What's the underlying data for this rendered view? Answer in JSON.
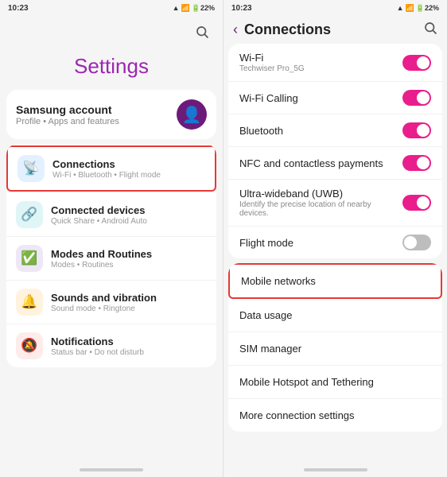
{
  "left": {
    "status": {
      "time": "10:23",
      "icons": "📶🔋22%"
    },
    "title": "Settings",
    "account": {
      "name": "Samsung account",
      "sub": "Profile • Apps and features"
    },
    "items": [
      {
        "id": "connections",
        "icon": "📡",
        "iconClass": "icon-blue",
        "title": "Connections",
        "sub": "Wi-Fi • Bluetooth • Flight mode",
        "highlighted": true
      },
      {
        "id": "connected-devices",
        "icon": "🔗",
        "iconClass": "icon-teal",
        "title": "Connected devices",
        "sub": "Quick Share • Android Auto",
        "highlighted": false
      },
      {
        "id": "modes-routines",
        "icon": "✅",
        "iconClass": "icon-purple",
        "title": "Modes and Routines",
        "sub": "Modes • Routines",
        "highlighted": false
      },
      {
        "id": "sounds-vibration",
        "icon": "🔔",
        "iconClass": "icon-orange",
        "title": "Sounds and vibration",
        "sub": "Sound mode • Ringtone",
        "highlighted": false
      },
      {
        "id": "notifications",
        "icon": "🔕",
        "iconClass": "icon-red",
        "title": "Notifications",
        "sub": "Status bar • Do not disturb",
        "highlighted": false
      }
    ]
  },
  "right": {
    "status": {
      "time": "10:23",
      "icons": "📶🔋22%"
    },
    "header": {
      "back_label": "‹",
      "title": "Connections",
      "search_label": "🔍"
    },
    "toggle_items": [
      {
        "id": "wifi",
        "title": "Wi-Fi",
        "sub": "Techwiser Pro_5G",
        "on": true
      },
      {
        "id": "wifi-calling",
        "title": "Wi-Fi Calling",
        "sub": "",
        "on": true
      },
      {
        "id": "bluetooth",
        "title": "Bluetooth",
        "sub": "",
        "on": true
      },
      {
        "id": "nfc",
        "title": "NFC and contactless payments",
        "sub": "",
        "on": true
      },
      {
        "id": "uwb",
        "title": "Ultra-wideband (UWB)",
        "sub": "Identify the precise location of nearby devices.",
        "on": true
      },
      {
        "id": "flight-mode",
        "title": "Flight mode",
        "sub": "",
        "on": false
      }
    ],
    "plain_items": [
      {
        "id": "mobile-networks",
        "title": "Mobile networks",
        "highlighted": true
      },
      {
        "id": "data-usage",
        "title": "Data usage",
        "highlighted": false
      },
      {
        "id": "sim-manager",
        "title": "SIM manager",
        "highlighted": false
      },
      {
        "id": "mobile-hotspot",
        "title": "Mobile Hotspot and Tethering",
        "highlighted": false
      },
      {
        "id": "more-connection",
        "title": "More connection settings",
        "highlighted": false
      }
    ]
  }
}
